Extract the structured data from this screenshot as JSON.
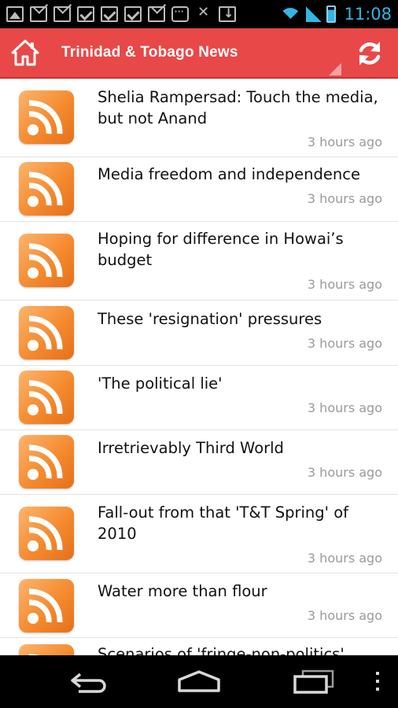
{
  "status_bar": {
    "notifications": [
      "picture-icon",
      "mail-icon",
      "mail-icon",
      "check-icon",
      "check-icon",
      "check-icon",
      "mail-icon",
      "chat-icon",
      "missed-call-icon",
      "download-icon"
    ],
    "time": "11:08",
    "accent_color": "#33b5e5"
  },
  "app_bar": {
    "title": "Trinidad & Tobago News",
    "background": "#e84848",
    "home_icon": "home-icon",
    "refresh_icon": "refresh-icon"
  },
  "feed": {
    "items": [
      {
        "title": "Shelia Rampersad: Touch the media, but not Anand",
        "time": "3 hours ago"
      },
      {
        "title": "Media freedom and independence",
        "time": "3 hours ago"
      },
      {
        "title": "Hoping for difference in Howai’s budget",
        "time": "3 hours ago"
      },
      {
        "title": "These 'resignation' pressures",
        "time": "3 hours ago"
      },
      {
        "title": "'The political lie'",
        "time": "3 hours ago"
      },
      {
        "title": "Irretrievably Third World",
        "time": "3 hours ago"
      },
      {
        "title": "Fall-out from that 'T&T Spring' of 2010",
        "time": "3 hours ago"
      },
      {
        "title": "Water more than flour",
        "time": "3 hours ago"
      },
      {
        "title": "Scenarios of 'fringe-non-politics'",
        "time": ""
      }
    ],
    "item_icon": "rss-icon"
  },
  "nav_bar": {
    "buttons": [
      "back-icon",
      "home-nav-icon",
      "recents-icon",
      "menu-icon"
    ]
  }
}
